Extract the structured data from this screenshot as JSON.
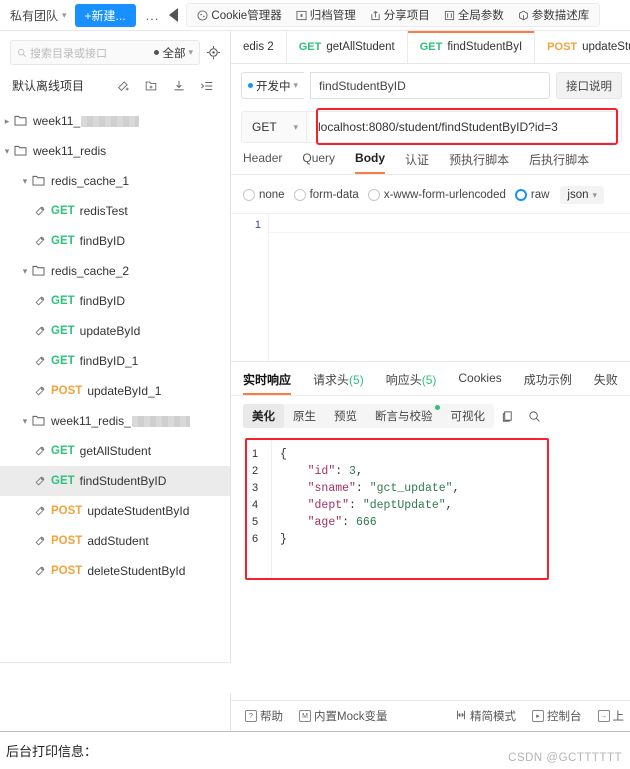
{
  "topbar": {
    "team_label": "私有团队",
    "new_button": "+新建...",
    "more": "...",
    "tools": [
      {
        "label": "Cookie管理器",
        "icon": "cookie-icon"
      },
      {
        "label": "归档管理",
        "icon": "archive-icon"
      },
      {
        "label": "分享项目",
        "icon": "share-icon"
      },
      {
        "label": "全局参数",
        "icon": "global-params-icon"
      },
      {
        "label": "参数描述库",
        "icon": "param-library-icon"
      }
    ]
  },
  "sidebar": {
    "search_placeholder": "搜索目录或接口",
    "filter_label": "全部",
    "project_name": "默认离线项目",
    "action_icons": [
      "add-api-icon",
      "new-folder-icon",
      "import-icon",
      "collapse-tree-icon"
    ],
    "tree": [
      {
        "type": "folder",
        "label": "week11_",
        "redacted": true,
        "expanded": false,
        "indent": 0
      },
      {
        "type": "folder",
        "label": "week11_redis",
        "redacted": false,
        "expanded": true,
        "indent": 0
      },
      {
        "type": "folder",
        "label": "redis_cache_1",
        "redacted": false,
        "expanded": true,
        "indent": 1
      },
      {
        "type": "api",
        "method": "GET",
        "label": "redisTest",
        "indent": 2
      },
      {
        "type": "api",
        "method": "GET",
        "label": "findByID",
        "indent": 2
      },
      {
        "type": "folder",
        "label": "redis_cache_2",
        "redacted": false,
        "expanded": true,
        "indent": 1
      },
      {
        "type": "api",
        "method": "GET",
        "label": "findByID",
        "indent": 2
      },
      {
        "type": "api",
        "method": "GET",
        "label": "updateById",
        "indent": 2
      },
      {
        "type": "api",
        "method": "GET",
        "label": "findByID_1",
        "indent": 2
      },
      {
        "type": "api",
        "method": "POST",
        "label": "updateById_1",
        "indent": 2
      },
      {
        "type": "folder",
        "label": "week11_redis_",
        "redacted": true,
        "expanded": true,
        "indent": 1
      },
      {
        "type": "api",
        "method": "GET",
        "label": "getAllStudent",
        "indent": 2
      },
      {
        "type": "api",
        "method": "GET",
        "label": "findStudentByID",
        "indent": 2,
        "selected": true
      },
      {
        "type": "api",
        "method": "POST",
        "label": "updateStudentById",
        "indent": 2
      },
      {
        "type": "api",
        "method": "POST",
        "label": "addStudent",
        "indent": 2
      },
      {
        "type": "api",
        "method": "POST",
        "label": "deleteStudentById",
        "indent": 2
      }
    ]
  },
  "main": {
    "tabs": [
      {
        "method": "",
        "label": "edis 2",
        "active": false
      },
      {
        "method": "GET",
        "label": "getAllStudent",
        "active": false
      },
      {
        "method": "GET",
        "label": "findStudentByI",
        "active": true
      },
      {
        "method": "POST",
        "label": "updateStuden",
        "active": false
      }
    ],
    "status_label": "开发中",
    "api_name": "findStudentByID",
    "doc_button": "接口说明",
    "http_method": "GET",
    "url": "localhost:8080/student/findStudentByID?id=3",
    "request_tabs": [
      {
        "label": "Header",
        "active": false
      },
      {
        "label": "Query",
        "active": false
      },
      {
        "label": "Body",
        "active": true
      },
      {
        "label": "认证",
        "active": false
      },
      {
        "label": "预执行脚本",
        "active": false
      },
      {
        "label": "后执行脚本",
        "active": false
      }
    ],
    "body_types": [
      {
        "label": "none",
        "selected": false
      },
      {
        "label": "form-data",
        "selected": false
      },
      {
        "label": "x-www-form-urlencoded",
        "selected": false
      },
      {
        "label": "raw",
        "selected": true
      }
    ],
    "raw_format": "json",
    "editor_line_number": "1",
    "response_tabs": [
      {
        "label": "实时响应",
        "count": "",
        "active": true
      },
      {
        "label": "请求头",
        "count": "(5)",
        "active": false
      },
      {
        "label": "响应头",
        "count": "(5)",
        "active": false
      },
      {
        "label": "Cookies",
        "count": "",
        "active": false
      },
      {
        "label": "成功示例",
        "count": "",
        "active": false
      },
      {
        "label": "失败",
        "count": "",
        "active": false
      }
    ],
    "view_buttons": [
      {
        "label": "美化",
        "active": true,
        "dot": false
      },
      {
        "label": "原生",
        "active": false,
        "dot": false
      },
      {
        "label": "预览",
        "active": false,
        "dot": false
      },
      {
        "label": "断言与校验",
        "active": false,
        "dot": true
      },
      {
        "label": "可视化",
        "active": false,
        "dot": false
      }
    ],
    "view_icons": [
      "copy-icon",
      "search-icon"
    ],
    "response_json": {
      "lines": [
        "1",
        "2",
        "3",
        "4",
        "5",
        "6"
      ],
      "values": {
        "id": "3",
        "sname": "gct_update",
        "dept": "deptUpdate",
        "age": "666"
      }
    },
    "statusbar": [
      {
        "label": "帮助",
        "icon": "help-icon"
      },
      {
        "label": "内置Mock变量",
        "icon": "mock-icon"
      },
      {
        "label": "精简模式",
        "icon": "compact-icon"
      },
      {
        "label": "控制台",
        "icon": "console-icon"
      },
      {
        "label": "上",
        "icon": "upload-icon"
      }
    ]
  },
  "bottom": {
    "caption": "后台打印信息：",
    "watermark": "CSDN @GCTTTTTT"
  },
  "colors": {
    "accent": "#ff7a45",
    "primary": "#1890ff",
    "get": "#2ec27e",
    "post": "#f2a33c",
    "highlight_box": "#f5222d"
  }
}
